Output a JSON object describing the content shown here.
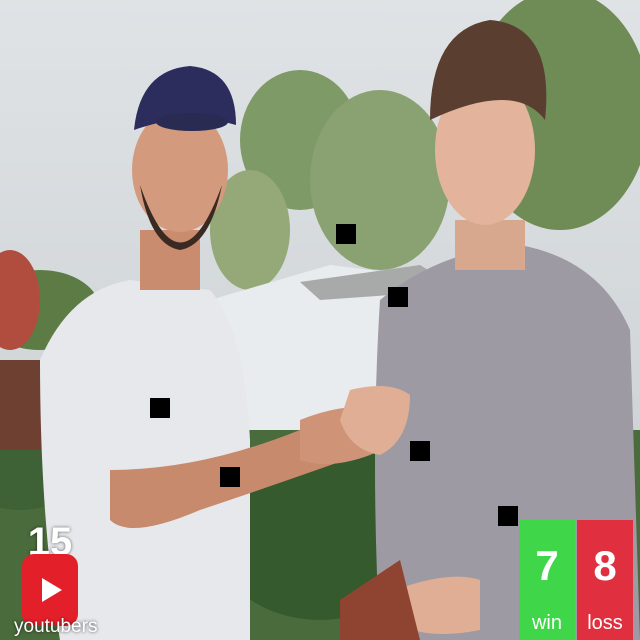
{
  "overlay": {
    "youtuber_count": "15",
    "youtuber_label": "youtubers",
    "win_count": "7",
    "win_label": "win",
    "loss_count": "8",
    "loss_label": "loss"
  },
  "colors": {
    "win_bg": "#3fd64a",
    "loss_bg": "#e0303f",
    "youtube_red": "#e3202a"
  },
  "icons": {
    "badge": "youtube-play-icon"
  }
}
